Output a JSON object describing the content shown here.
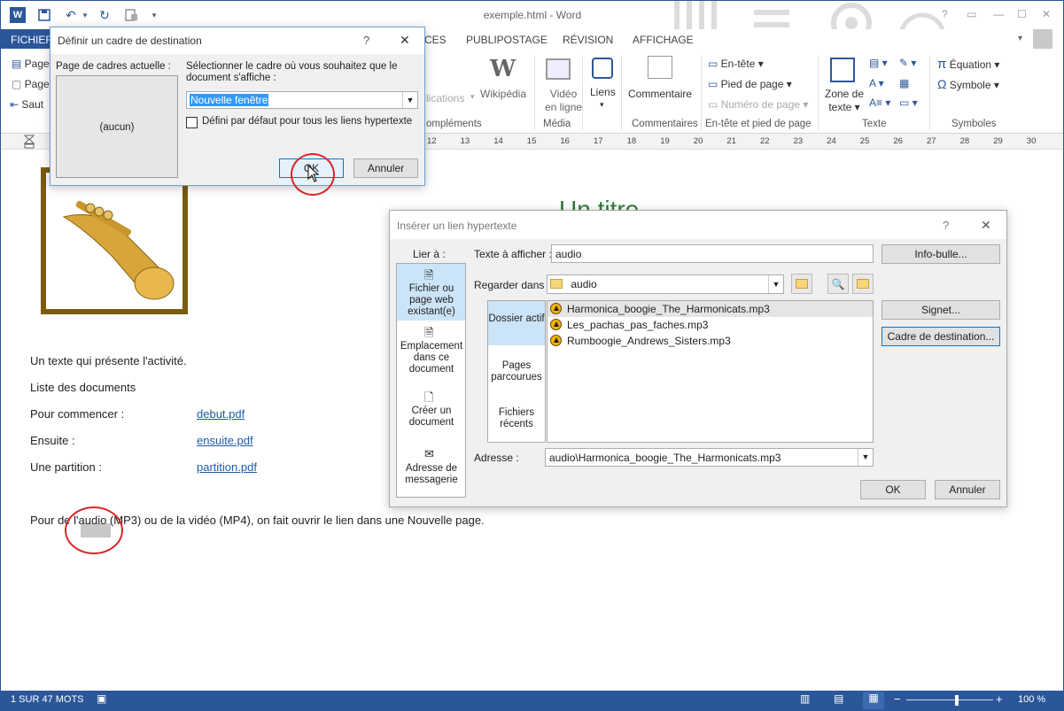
{
  "window": {
    "title": "exemple.html - Word",
    "help": "?",
    "buttons": [
      "?",
      "▭",
      "—",
      "☐",
      "✕"
    ]
  },
  "qat": {
    "word_logo": "W",
    "save": "💾",
    "undo": "↶",
    "undo_arrow": "▾",
    "redo": "↻",
    "customize": "▾"
  },
  "tabs": {
    "fichier": "FICHIER",
    "items": [
      "CES",
      "PUBLIPOSTAGE",
      "RÉVISION",
      "AFFICHAGE"
    ]
  },
  "ribbon": {
    "left": [
      "Page",
      "Page",
      "Saut"
    ],
    "applications_partial": "lications",
    "complements_partial": "ompléments",
    "wikipedia": "Wikipédia",
    "video": [
      "Vidéo",
      "en ligne"
    ],
    "media": "Média",
    "liens": "Liens",
    "commentaire": "Commentaire",
    "commentaires": "Commentaires",
    "entete": "En-tête",
    "pied": "Pied de page",
    "numero": "Numéro de page",
    "entete_pied": "En-tête et pied de page",
    "zone": [
      "Zone de",
      "texte"
    ],
    "texte": "Texte",
    "equation": "Équation",
    "symbole": "Symbole",
    "symboles": "Symboles"
  },
  "ruler_numbers": [
    "12",
    "13",
    "14",
    "15",
    "16",
    "17",
    "18",
    "19",
    "20",
    "21",
    "22",
    "23",
    "24",
    "25",
    "26",
    "27",
    "28",
    "29",
    "30"
  ],
  "document": {
    "heading_partial": "Un titre",
    "intro": "Un texte qui présente l'activité.",
    "list_title": "Liste des documents",
    "rows": [
      {
        "label": "Pour commencer :",
        "link": "debut.pdf"
      },
      {
        "label": "Ensuite :",
        "link": "ensuite.pdf"
      },
      {
        "label": "Une partition :",
        "link": "partition.pdf"
      }
    ],
    "paragraph": "Pour de l'audio (MP3) ou de la vidéo (MP4), on fait ouvrir le lien dans une Nouvelle page."
  },
  "status": {
    "words": "1 SUR 47 MOTS",
    "zoom": "100 %",
    "zoom_level": 0.58
  },
  "frame_dialog": {
    "title": "Définir un cadre de destination",
    "help": "?",
    "close": "✕",
    "current_label": "Page de cadres actuelle :",
    "current_value": "(aucun)",
    "select_label": "Sélectionner le cadre où vous souhaitez que le document s'affiche :",
    "select_value": "Nouvelle fenêtre",
    "checkbox_label": "Défini par défaut pour tous les liens hypertexte",
    "ok": "OK",
    "cancel": "Annuler"
  },
  "link_dialog": {
    "title": "Insérer un lien hypertexte",
    "help": "?",
    "close": "✕",
    "link_to": "Lier à :",
    "nav": [
      "Fichier ou page web existant(e)",
      "Emplacement dans ce document",
      "Créer un document",
      "Adresse de messagerie"
    ],
    "text_label": "Texte à afficher :",
    "text_value": "audio",
    "tooltip_btn": "Info-bulle...",
    "look_in_label": "Regarder dans :",
    "look_in_value": "audio",
    "subnav": [
      "Dossier actif",
      "Pages parcourues",
      "Fichiers récents"
    ],
    "files": [
      "Harmonica_boogie_The_Harmonicats.mp3",
      "Les_pachas_pas_faches.mp3",
      "Rumboogie_Andrews_Sisters.mp3"
    ],
    "bookmark_btn": "Signet...",
    "target_btn": "Cadre de destination...",
    "address_label": "Adresse :",
    "address_value": "audio\\Harmonica_boogie_The_Harmonicats.mp3",
    "ok": "OK",
    "cancel": "Annuler"
  }
}
